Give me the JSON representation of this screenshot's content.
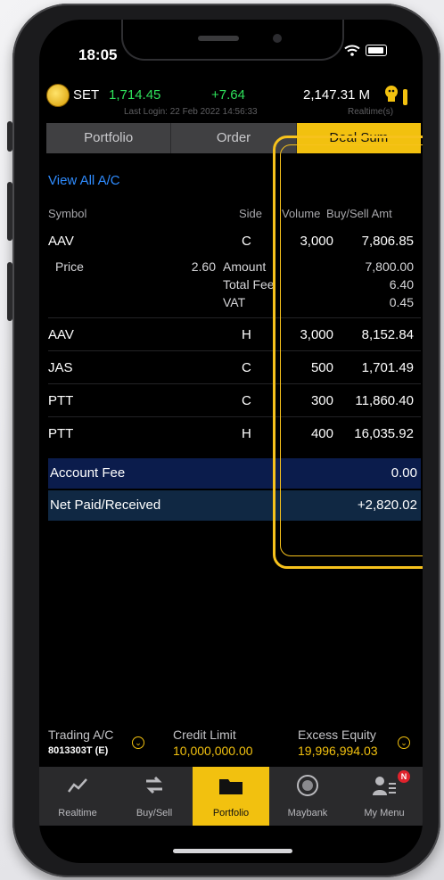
{
  "status_bar": {
    "time": "18:05"
  },
  "market": {
    "index_name": "SET",
    "index_value": "1,714.45",
    "change": "+7.64",
    "volume": "2,147.31 M",
    "last_login": "Last Login: 22 Feb 2022 14:56:33",
    "realtime": "Realtime(s)"
  },
  "tabs": [
    {
      "label": "Portfolio"
    },
    {
      "label": "Order"
    },
    {
      "label": "Deal Sum"
    }
  ],
  "view_all": "View All A/C",
  "columns": {
    "symbol": "Symbol",
    "side": "Side",
    "volume": "Volume",
    "amount": "Buy/Sell Amt"
  },
  "deals": [
    {
      "symbol": "AAV",
      "side": "C",
      "volume": "3,000",
      "amount": "7,806.85"
    },
    {
      "symbol": "AAV",
      "side": "H",
      "volume": "3,000",
      "amount": "8,152.84"
    },
    {
      "symbol": "JAS",
      "side": "C",
      "volume": "500",
      "amount": "1,701.49"
    },
    {
      "symbol": "PTT",
      "side": "C",
      "volume": "300",
      "amount": "11,860.40"
    },
    {
      "symbol": "PTT",
      "side": "H",
      "volume": "400",
      "amount": "16,035.92"
    }
  ],
  "detail": {
    "price_label": "Price",
    "price_value": "2.60",
    "amount_label": "Amount",
    "amount_value": "7,800.00",
    "fee_label": "Total Fee",
    "fee_value": "6.40",
    "vat_label": "VAT",
    "vat_value": "0.45"
  },
  "summary": {
    "account_fee_label": "Account Fee",
    "account_fee_value": "0.00",
    "net_label": "Net Paid/Received",
    "net_value": "+2,820.02"
  },
  "footer": {
    "trading_label": "Trading A/C",
    "trading_value": "8013303T (E)",
    "credit_label": "Credit Limit",
    "credit_value": "10,000,000.00",
    "excess_label": "Excess Equity",
    "excess_value": "19,996,994.03"
  },
  "nav": [
    {
      "label": "Realtime",
      "icon": "chart-line-icon"
    },
    {
      "label": "Buy/Sell",
      "icon": "swap-arrows-icon"
    },
    {
      "label": "Portfolio",
      "icon": "folder-icon"
    },
    {
      "label": "Maybank",
      "icon": "maybank-logo-icon"
    },
    {
      "label": "My Menu",
      "icon": "user-menu-icon"
    }
  ],
  "nav_badge": "N",
  "colors": {
    "accent": "#f2c10f",
    "up": "#2ee05a",
    "link": "#2f8cff",
    "band_account": "#0b1c4c",
    "band_net": "#102843"
  }
}
